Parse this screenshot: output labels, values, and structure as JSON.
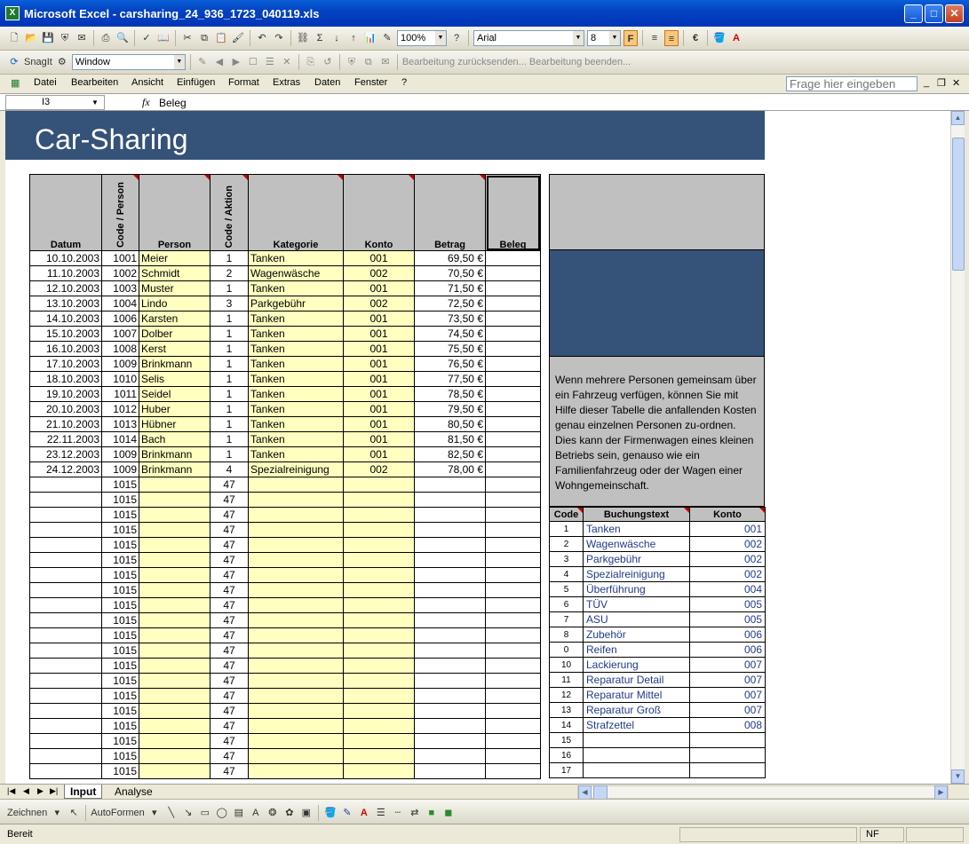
{
  "window": {
    "title": "Microsoft Excel - carsharing_24_936_1723_040119.xls",
    "app_icon": "X"
  },
  "toolbar1": {
    "zoom": "100%",
    "font": "Arial",
    "size": "8",
    "bold": "F",
    "currency": "€"
  },
  "toolbar2": {
    "snagit": "SnagIt",
    "window_combo": "Window",
    "send_back": "Bearbeitung zurücksenden...",
    "end_edit": "Bearbeitung beenden..."
  },
  "menu": {
    "items": [
      "Datei",
      "Bearbeiten",
      "Ansicht",
      "Einfügen",
      "Format",
      "Extras",
      "Daten",
      "Fenster",
      "?"
    ],
    "help_placeholder": "Frage hier eingeben"
  },
  "formula_bar": {
    "cell_ref": "I3",
    "fx": "fx",
    "value": "Beleg"
  },
  "sheet": {
    "title": "Car-Sharing",
    "headers": {
      "datum": "Datum",
      "code_person": "Code / Person",
      "person": "Person",
      "code_aktion": "Code / Aktion",
      "kategorie": "Kategorie",
      "konto": "Konto",
      "betrag": "Betrag",
      "beleg": "Beleg"
    },
    "rows": [
      [
        "10.10.2003",
        "1001",
        "Meier",
        "1",
        "Tanken",
        "001",
        "69,50 €"
      ],
      [
        "11.10.2003",
        "1002",
        "Schmidt",
        "2",
        "Wagenwäsche",
        "002",
        "70,50 €"
      ],
      [
        "12.10.2003",
        "1003",
        "Muster",
        "1",
        "Tanken",
        "001",
        "71,50 €"
      ],
      [
        "13.10.2003",
        "1004",
        "Lindo",
        "3",
        "Parkgebühr",
        "002",
        "72,50 €"
      ],
      [
        "14.10.2003",
        "1006",
        "Karsten",
        "1",
        "Tanken",
        "001",
        "73,50 €"
      ],
      [
        "15.10.2003",
        "1007",
        "Dolber",
        "1",
        "Tanken",
        "001",
        "74,50 €"
      ],
      [
        "16.10.2003",
        "1008",
        "Kerst",
        "1",
        "Tanken",
        "001",
        "75,50 €"
      ],
      [
        "17.10.2003",
        "1009",
        "Brinkmann",
        "1",
        "Tanken",
        "001",
        "76,50 €"
      ],
      [
        "18.10.2003",
        "1010",
        "Selis",
        "1",
        "Tanken",
        "001",
        "77,50 €"
      ],
      [
        "19.10.2003",
        "1011",
        "Seidel",
        "1",
        "Tanken",
        "001",
        "78,50 €"
      ],
      [
        "20.10.2003",
        "1012",
        "Huber",
        "1",
        "Tanken",
        "001",
        "79,50 €"
      ],
      [
        "21.10.2003",
        "1013",
        "Hübner",
        "1",
        "Tanken",
        "001",
        "80,50 €"
      ],
      [
        "22.11.2003",
        "1014",
        "Bach",
        "1",
        "Tanken",
        "001",
        "81,50 €"
      ],
      [
        "23.12.2003",
        "1009",
        "Brinkmann",
        "1",
        "Tanken",
        "001",
        "82,50 €"
      ],
      [
        "24.12.2003",
        "1009",
        "Brinkmann",
        "4",
        "Spezialreinigung",
        "002",
        "78,00 €"
      ],
      [
        "",
        "1015",
        "",
        "47",
        "",
        "",
        ""
      ],
      [
        "",
        "1015",
        "",
        "47",
        "",
        "",
        ""
      ],
      [
        "",
        "1015",
        "",
        "47",
        "",
        "",
        ""
      ],
      [
        "",
        "1015",
        "",
        "47",
        "",
        "",
        ""
      ],
      [
        "",
        "1015",
        "",
        "47",
        "",
        "",
        ""
      ],
      [
        "",
        "1015",
        "",
        "47",
        "",
        "",
        ""
      ],
      [
        "",
        "1015",
        "",
        "47",
        "",
        "",
        ""
      ],
      [
        "",
        "1015",
        "",
        "47",
        "",
        "",
        ""
      ],
      [
        "",
        "1015",
        "",
        "47",
        "",
        "",
        ""
      ],
      [
        "",
        "1015",
        "",
        "47",
        "",
        "",
        ""
      ],
      [
        "",
        "1015",
        "",
        "47",
        "",
        "",
        ""
      ],
      [
        "",
        "1015",
        "",
        "47",
        "",
        "",
        ""
      ],
      [
        "",
        "1015",
        "",
        "47",
        "",
        "",
        ""
      ],
      [
        "",
        "1015",
        "",
        "47",
        "",
        "",
        ""
      ],
      [
        "",
        "1015",
        "",
        "47",
        "",
        "",
        ""
      ],
      [
        "",
        "1015",
        "",
        "47",
        "",
        "",
        ""
      ],
      [
        "",
        "1015",
        "",
        "47",
        "",
        "",
        ""
      ],
      [
        "",
        "1015",
        "",
        "47",
        "",
        "",
        ""
      ],
      [
        "",
        "1015",
        "",
        "47",
        "",
        "",
        ""
      ],
      [
        "",
        "1015",
        "",
        "47",
        "",
        "",
        ""
      ]
    ],
    "info_text": "Wenn mehrere Personen gemeinsam über ein Fahrzeug verfügen, können Sie mit Hilfe dieser Tabelle die anfallenden Kosten genau einzelnen Personen zu-ordnen. Dies kann der Firmenwagen eines kleinen Betriebs sein, genauso wie ein Familienfahrzeug oder der Wagen einer Wohngemeinschaft.",
    "codes_headers": {
      "code": "Code",
      "text": "Buchungstext",
      "konto": "Konto"
    },
    "codes": [
      [
        "1",
        "Tanken",
        "001"
      ],
      [
        "2",
        "Wagenwäsche",
        "002"
      ],
      [
        "3",
        "Parkgebühr",
        "002"
      ],
      [
        "4",
        "Spezialreinigung",
        "002"
      ],
      [
        "5",
        "Überführung",
        "004"
      ],
      [
        "6",
        "TÜV",
        "005"
      ],
      [
        "7",
        "ASU",
        "005"
      ],
      [
        "8",
        "Zubehör",
        "006"
      ],
      [
        "0",
        "Reifen",
        "006"
      ],
      [
        "10",
        "Lackierung",
        "007"
      ],
      [
        "11",
        "Reparatur Detail",
        "007"
      ],
      [
        "12",
        "Reparatur Mittel",
        "007"
      ],
      [
        "13",
        "Reparatur Groß",
        "007"
      ],
      [
        "14",
        "Strafzettel",
        "008"
      ],
      [
        "15",
        "",
        ""
      ],
      [
        "16",
        "",
        ""
      ],
      [
        "17",
        "",
        ""
      ]
    ]
  },
  "sheet_tabs": [
    "Input",
    "Analyse"
  ],
  "drawing": {
    "zeichnen": "Zeichnen",
    "autoformen": "AutoFormen"
  },
  "status": {
    "left": "Bereit",
    "nf": "NF"
  }
}
